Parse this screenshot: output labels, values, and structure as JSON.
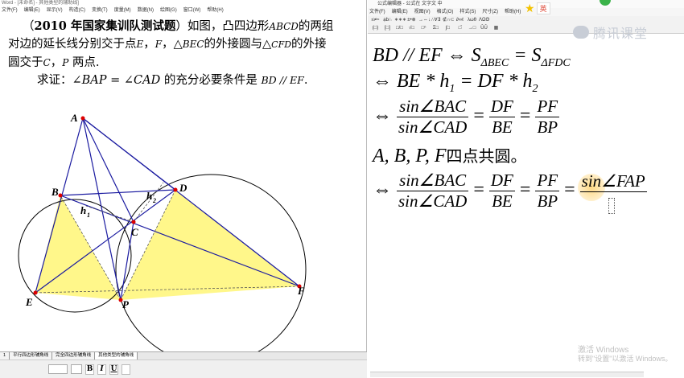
{
  "left_window": {
    "title": "Word - [未命名] - 其他类型的辅助线]",
    "menu": [
      "文件(F)",
      "编辑(E)",
      "显示(V)",
      "构造(C)",
      "变换(T)",
      "度量(M)",
      "数据(N)",
      "绘图(G)",
      "窗口(W)",
      "帮助(H)"
    ],
    "problem": {
      "line1_prefix": "（",
      "year_source": "2010 年国家集训队测试题",
      "line1_suffix": "）如图，凸四边形",
      "abcd": "ABCD",
      "line1_end": "的两组",
      "line2": "对边的延长线分别交于点",
      "e": "E",
      "comma1": "，",
      "f": "F",
      "comma2": "，△",
      "bec": "BEC",
      "line2_mid": "的外接圆与△",
      "cfd": "CFD",
      "line2_end": "的外接",
      "line3_a": "圆交于",
      "c": "C",
      "comma3": "，",
      "p": "P",
      "line3_b": " 两点.",
      "prove_label": "求证：",
      "prove_expr": "∠BAP = ∠CAD",
      "prove_mid": " 的充分必要条件是 ",
      "prove_cond": "BD // EF",
      "prove_end": "."
    },
    "figure_labels": {
      "A": "A",
      "B": "B",
      "C": "C",
      "D": "D",
      "E": "E",
      "F": "F",
      "P": "P",
      "h1": "h",
      "h1_sub": "1",
      "h2": "h",
      "h2_sub": "2"
    },
    "sheet_tabs": [
      "1",
      "平行四边形辅角线",
      "完全四边形辅角线",
      "其他类型的辅角线"
    ],
    "format_buttons": [
      "B",
      "I",
      "U"
    ]
  },
  "right_window": {
    "title": "公式编辑器 - 公式在 文字文 中",
    "menu": [
      "文件(F)",
      "编辑(E)",
      "视图(V)",
      "格式(O)",
      "样式(S)",
      "尺寸(Z)",
      "帮助(H)"
    ],
    "toolbar_row1": [
      "≤≠≈",
      "ạb∴",
      "∗∗∗",
      "±•⊗",
      "→⇔↓",
      "∴∀∃",
      "∉∩⊂",
      "∂∞ℓ",
      "λωθ",
      "ΛΩΘ"
    ],
    "toolbar_row2": [
      "(□)",
      "[□]",
      "□/□",
      "√□",
      "□ⁿ",
      "Σ□",
      "∫□",
      "□̄",
      "→□",
      "ŪŪ",
      "▦"
    ],
    "ime_label": "英",
    "equations": {
      "l1": {
        "a": "BD // EF ⇔ S",
        "s1": "ΔBEC",
        "b": " = S",
        "s2": "ΔFDC"
      },
      "l2": {
        "a": "⇔ BE * h",
        "s1": "1",
        "b": " = DF * h",
        "s2": "2"
      },
      "l3": {
        "arrow": "⇔",
        "f1n": "sin∠BAC",
        "f1d": "sin∠CAD",
        "eq1": "=",
        "f2n": "DF",
        "f2d": "BE",
        "eq2": "=",
        "f3n": "PF",
        "f3d": "BP"
      },
      "l4": {
        "text": "A, B, P, F",
        "cn": "四点共圆。"
      },
      "l5": {
        "arrow": "⇔",
        "f1n": "sin∠BAC",
        "f1d": "sin∠CAD",
        "eq1": "=",
        "f2n": "DF",
        "f2d": "BE",
        "eq2": "=",
        "f3n": "PF",
        "f3d": "BP",
        "eq3": "=",
        "f4n": "sin∠FAP"
      }
    },
    "logo_text": "腾讯课堂",
    "watermark_line1": "激活 Windows",
    "watermark_line2": "转到\"设置\"以激活 Windows。"
  }
}
